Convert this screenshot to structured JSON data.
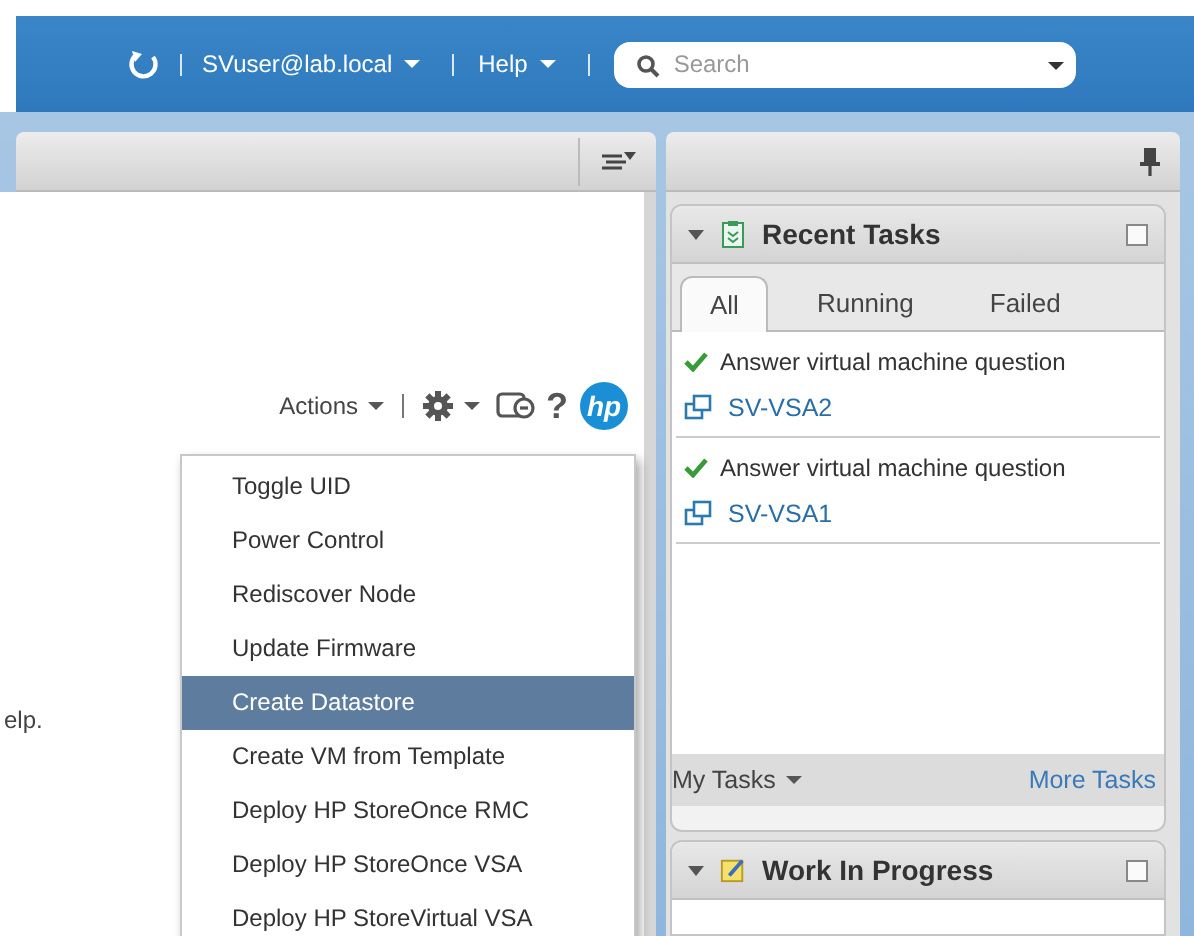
{
  "header": {
    "user": "SVuser@lab.local",
    "help": "Help",
    "search": {
      "placeholder": "Search"
    }
  },
  "main": {
    "actions": "Actions",
    "help_mark": "?",
    "logo": "hp",
    "partial_text": "elp.",
    "menu": [
      {
        "label": "Toggle UID",
        "selected": false
      },
      {
        "label": "Power Control",
        "selected": false
      },
      {
        "label": "Rediscover Node",
        "selected": false
      },
      {
        "label": "Update Firmware",
        "selected": false
      },
      {
        "label": "Create Datastore",
        "selected": true
      },
      {
        "label": "Create VM from Template",
        "selected": false
      },
      {
        "label": "Deploy HP StoreOnce RMC",
        "selected": false
      },
      {
        "label": "Deploy HP StoreOnce VSA",
        "selected": false
      },
      {
        "label": "Deploy HP StoreVirtual VSA",
        "selected": false
      }
    ]
  },
  "recent_tasks": {
    "title": "Recent Tasks",
    "tabs": [
      {
        "label": "All",
        "selected": true
      },
      {
        "label": "Running",
        "selected": false
      },
      {
        "label": "Failed",
        "selected": false
      }
    ],
    "tasks": [
      {
        "name": "Answer virtual machine question",
        "target": "SV-VSA2"
      },
      {
        "name": "Answer virtual machine question",
        "target": "SV-VSA1"
      }
    ],
    "my_tasks": "My Tasks",
    "more_tasks": "More Tasks"
  },
  "work_in_progress": {
    "title": "Work In Progress"
  }
}
